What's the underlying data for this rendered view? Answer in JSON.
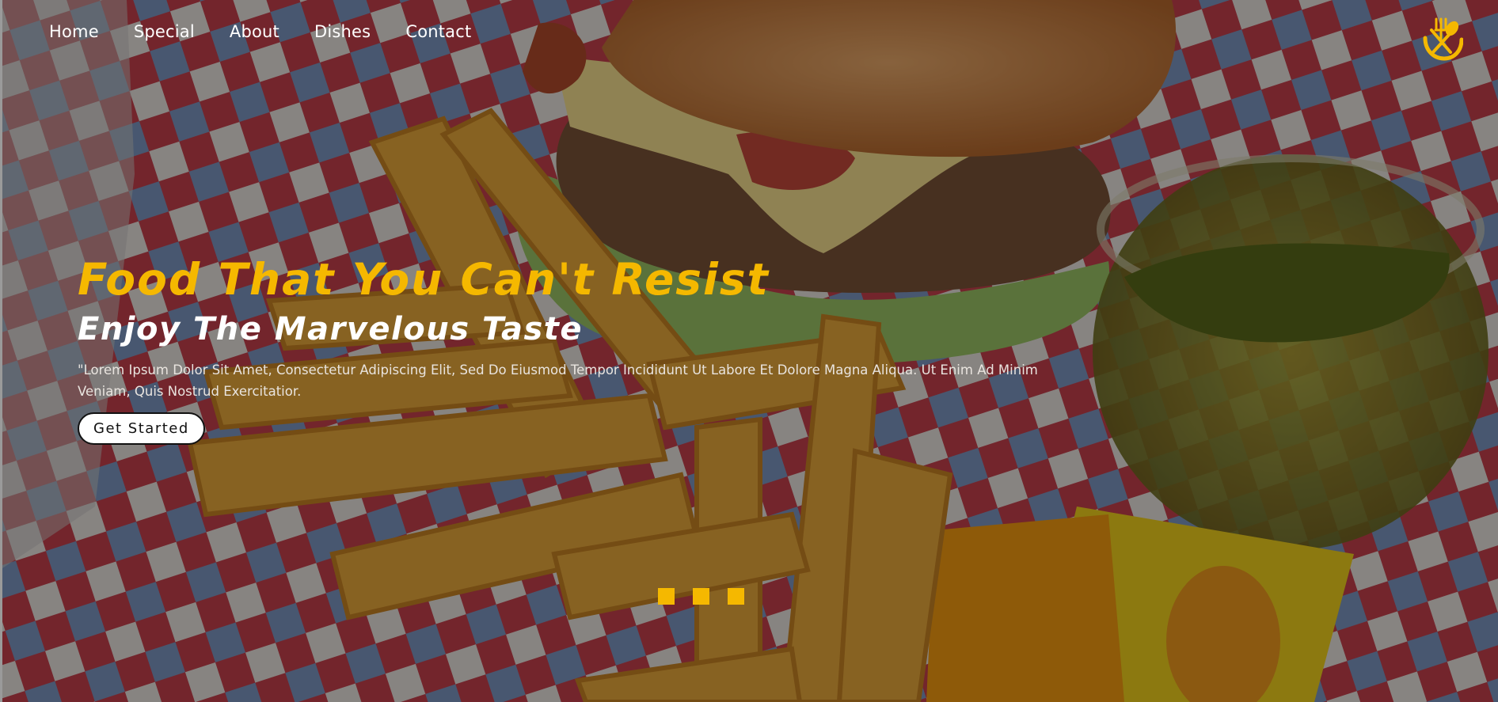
{
  "nav": {
    "items": [
      {
        "label": "Home"
      },
      {
        "label": "Special"
      },
      {
        "label": "About"
      },
      {
        "label": "Dishes"
      },
      {
        "label": "Contact"
      }
    ]
  },
  "logo": {
    "icon": "fork-spoon-logo-icon"
  },
  "hero": {
    "title": "Food That You Can't Resist",
    "subtitle": "Enjoy The Marvelous Taste",
    "description": "\"Lorem Ipsum Dolor Sit Amet, Consectetur Adipiscing Elit, Sed Do Eiusmod Tempor Incididunt Ut Labore Et Dolore Magna Aliqua. Ut Enim Ad Minim Veniam, Quis Nostrud Exercitatior.",
    "cta_label": "Get Started"
  },
  "slider": {
    "dot_count": 3
  },
  "colors": {
    "accent": "#f5b800",
    "text": "#ffffff",
    "button_bg": "#ffffff",
    "button_text": "#111111"
  }
}
